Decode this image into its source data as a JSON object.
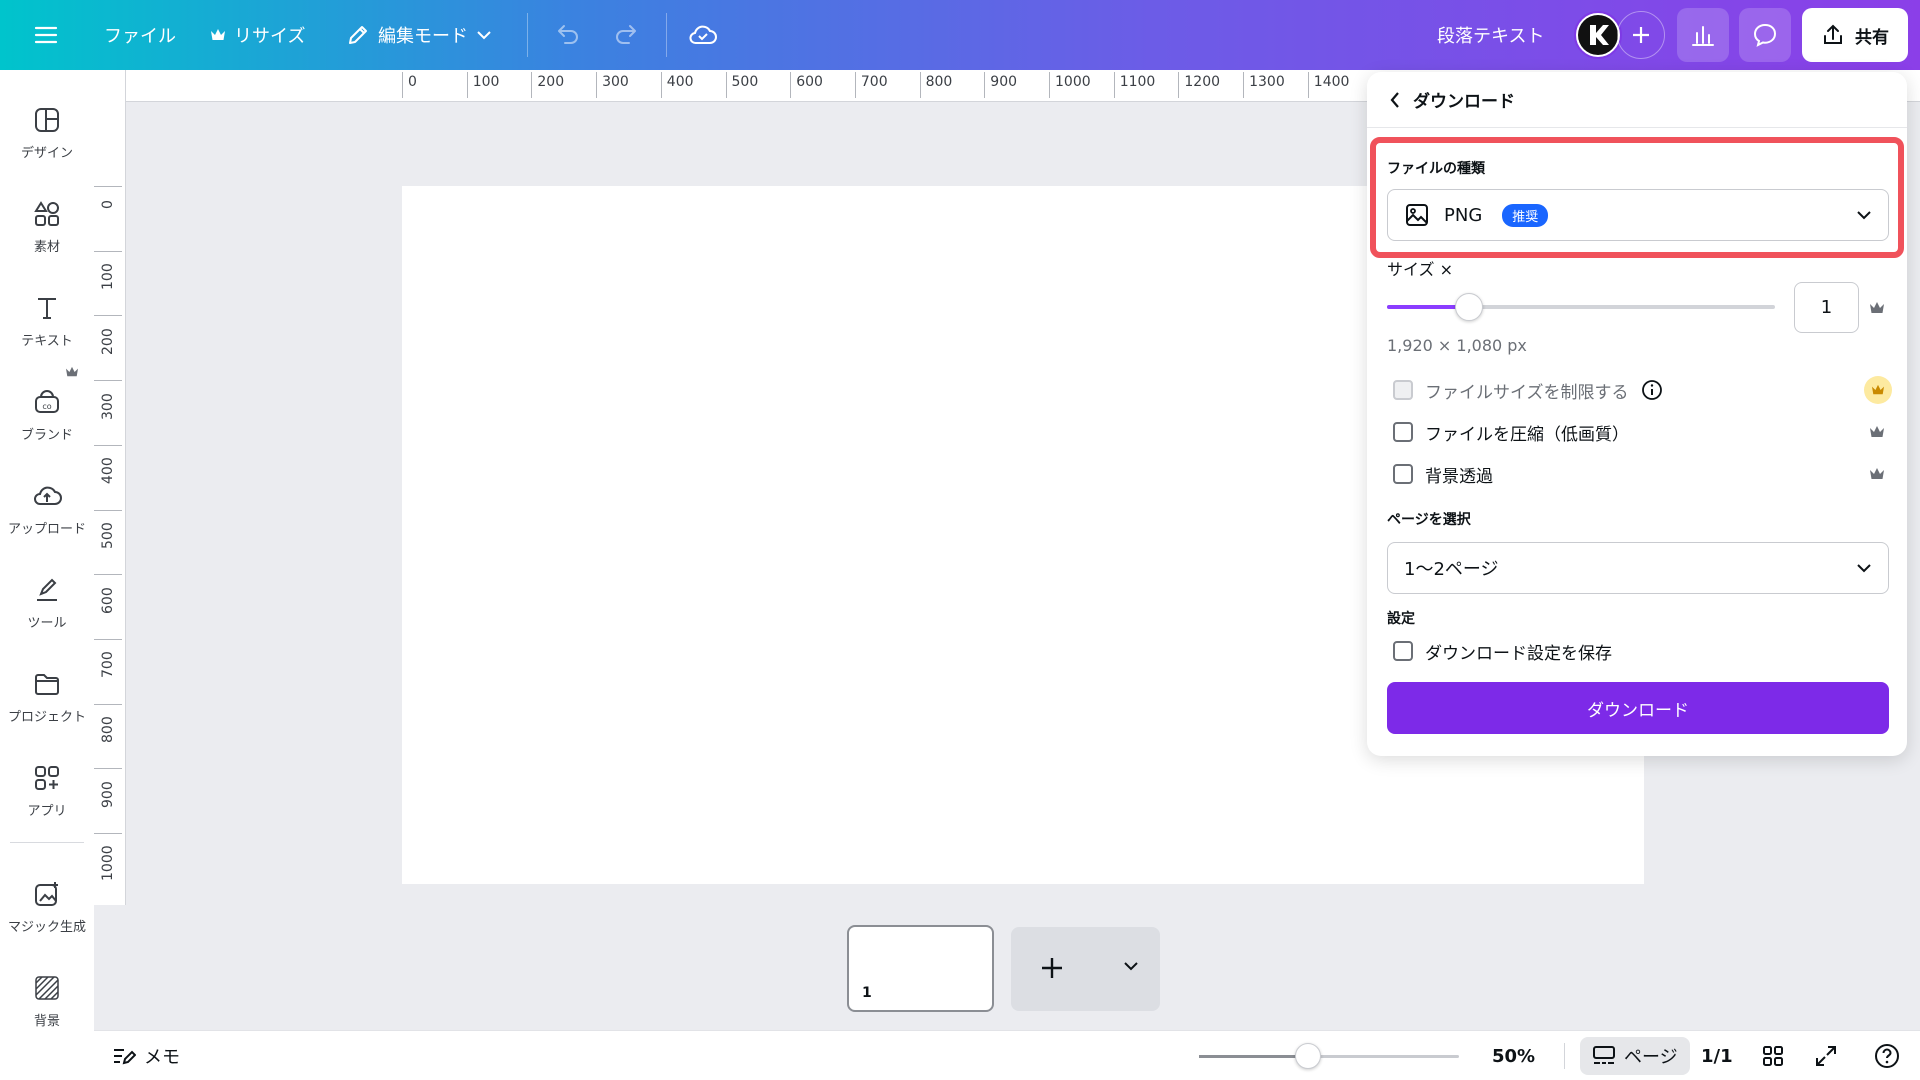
{
  "topbar": {
    "file_label": "ファイル",
    "resize_label": "リサイズ",
    "edit_mode_label": "編集モード",
    "paragraph_text_label": "段落テキスト",
    "share_label": "共有"
  },
  "sidebar": {
    "items": [
      {
        "label": "デザイン",
        "icon": "layout-icon"
      },
      {
        "label": "素材",
        "icon": "elements-icon"
      },
      {
        "label": "テキスト",
        "icon": "text-icon"
      },
      {
        "label": "ブランド",
        "icon": "brand-icon"
      },
      {
        "label": "アップロード",
        "icon": "upload-icon"
      },
      {
        "label": "ツール",
        "icon": "draw-icon"
      },
      {
        "label": "プロジェクト",
        "icon": "folder-icon"
      },
      {
        "label": "アプリ",
        "icon": "apps-icon"
      },
      {
        "label": "マジック生成",
        "icon": "magic-icon"
      },
      {
        "label": "背景",
        "icon": "background-icon"
      }
    ]
  },
  "ruler": {
    "x_ticks": [
      "0",
      "100",
      "200",
      "300",
      "400",
      "500",
      "600",
      "700",
      "800",
      "900",
      "1000",
      "1100",
      "1200",
      "1300",
      "1400"
    ],
    "y_ticks": [
      "0",
      "100",
      "200",
      "300",
      "400",
      "500",
      "600",
      "700",
      "800",
      "900",
      "1000"
    ]
  },
  "pages": {
    "thumb_number": "1"
  },
  "bottombar": {
    "notes_label": "メモ",
    "zoom": "50%",
    "page_view_label": "ページ",
    "page_count": "1/1"
  },
  "panel": {
    "title": "ダウンロード",
    "file_type_label": "ファイルの種類",
    "file_type_value": "PNG",
    "recommended_badge": "推奨",
    "size_label": "サイズ ×",
    "size_value": "1",
    "size_hint": "1,920 × 1,080 px",
    "limit_file_size_label": "ファイルサイズを制限する",
    "compress_label": "ファイルを圧縮（低画質）",
    "transparent_bg_label": "背景透過",
    "select_pages_label": "ページを選択",
    "pages_value": "1〜2ページ",
    "settings_label": "設定",
    "save_settings_label": "ダウンロード設定を保存",
    "download_button": "ダウンロード"
  },
  "colors": {
    "accent": "#7d2ae8",
    "highlight": "#f0525b",
    "badge": "#1a66ff"
  }
}
